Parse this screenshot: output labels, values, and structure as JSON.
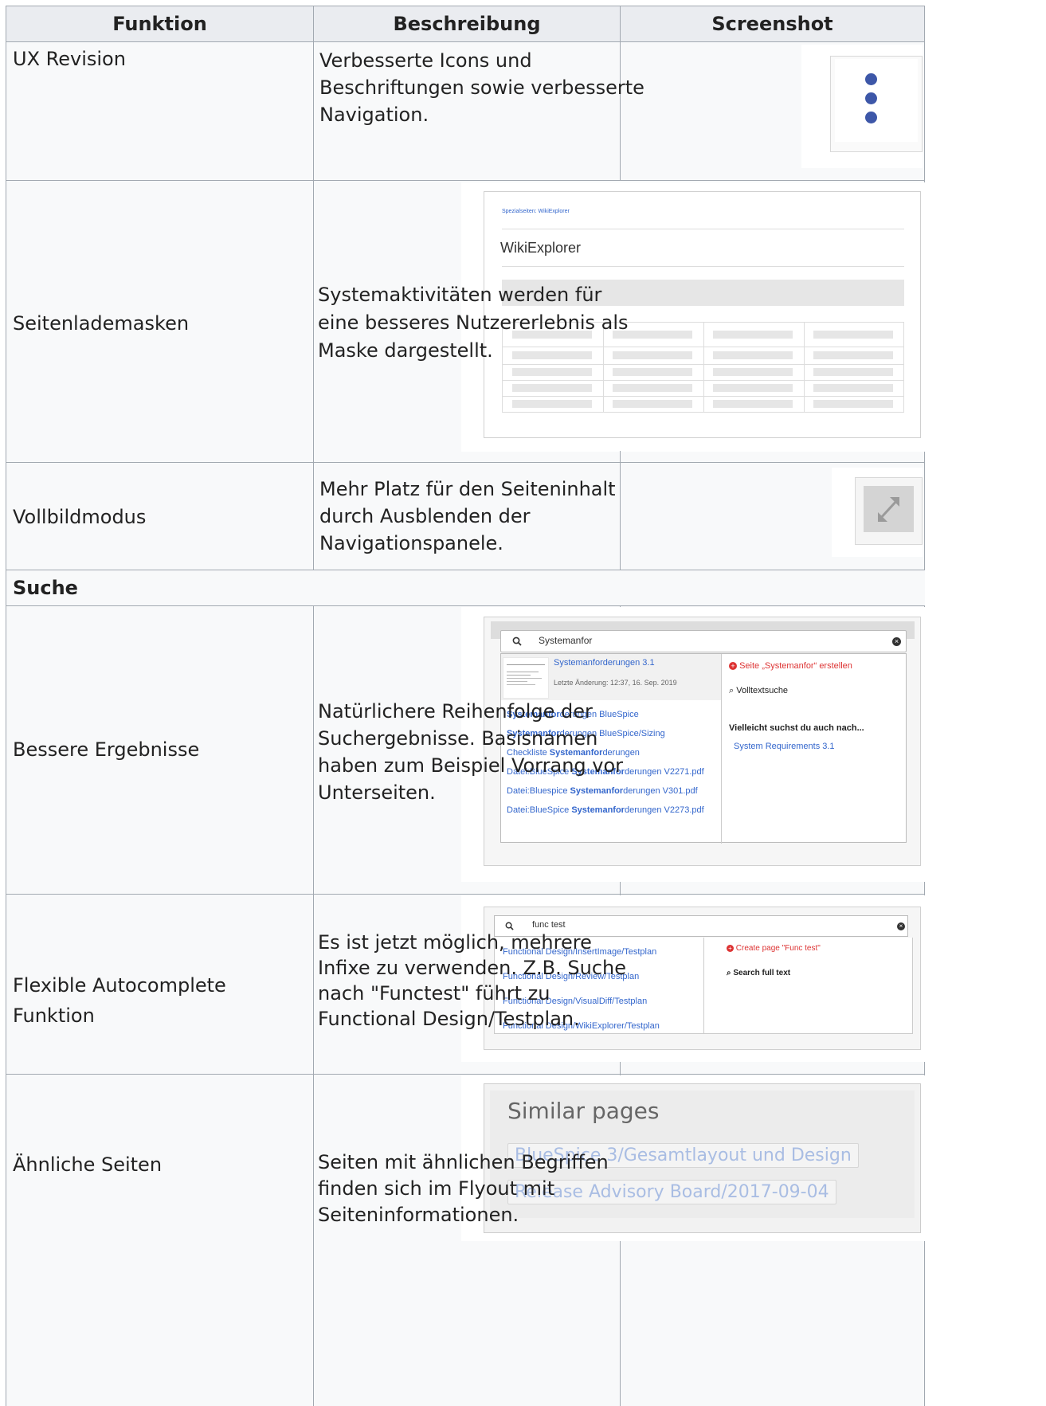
{
  "table": {
    "headers": [
      "Funktion",
      "Beschreibung",
      "Screenshot"
    ],
    "rows": [
      {
        "function": "UX Revision",
        "desc_lines": [
          "Verbesserte Icons und",
          "Beschriftungen sowie verbesserte",
          "Navigation."
        ]
      },
      {
        "function": "Seitenlademasken",
        "desc_lines": [
          "Systemaktivitäten werden für",
          "eine besseres Nutzererlebnis als",
          "Maske dargestellt."
        ]
      },
      {
        "function": "Vollbildmodus",
        "desc_lines": [
          "Mehr Platz für den Seiteninhalt",
          "durch Ausblenden der",
          "Navigationspanele."
        ]
      },
      {
        "section": "Suche"
      },
      {
        "function": "Bessere Ergebnisse",
        "desc_lines": [
          "Natürlichere Reihenfolge der",
          "Suchergebnisse. Basisnamen",
          "haben zum Beispiel Vorrang vor",
          "Unterseiten."
        ]
      },
      {
        "function": "Flexible Autocomplete Funktion",
        "desc_lines": [
          "Es ist jetzt möglich, mehrere",
          "Infixe zu verwenden. Z.B. Suche",
          "nach \"Functest\" führt zu",
          "Functional Design/Testplan."
        ]
      },
      {
        "function": "Ähnliche Seiten",
        "desc_lines": [
          "Seiten mit ähnlichen Begriffen",
          "finden sich im Flyout mit",
          "Seiteninformationen."
        ]
      }
    ]
  },
  "shots": {
    "wikiexplorer": {
      "breadcrumb": "Spezialseiten:  WikiExplorer",
      "title": "WikiExplorer"
    },
    "search1": {
      "query": "Systemanfor",
      "top_title": "Systemanforderungen 3.1",
      "top_meta": "Letzte Änderung: 12:37, 16. Sep. 2019",
      "results": [
        {
          "pre": "",
          "bold": "Systemanfor",
          "post": "derungen BlueSpice"
        },
        {
          "pre": "",
          "bold": "Systemanfor",
          "post": "derungen BlueSpice/Sizing"
        },
        {
          "pre": "Checkliste ",
          "bold": "Systemanfor",
          "post": "derungen"
        },
        {
          "pre": "Datei:BlueSpice ",
          "bold": "Systemanfor",
          "post": "derungen V2271.pdf"
        },
        {
          "pre": "Datei:Bluespice ",
          "bold": "Systemanfor",
          "post": "derungen V301.pdf"
        },
        {
          "pre": "Datei:BlueSpice ",
          "bold": "Systemanfor",
          "post": "derungen V2273.pdf"
        }
      ],
      "create": "Seite „Systemanfor“ erstellen",
      "fulltext": "Volltextsuche",
      "maybe_label": "Vielleicht suchst du auch nach...",
      "maybe_link": "System Requirements 3.1"
    },
    "search2": {
      "query": "func test",
      "results": [
        "Functional Design/InsertImage/Testplan",
        "Functional Design/Review/Testplan",
        "Functional Design/VisualDiff/Testplan",
        "Functional Design/WikiExplorer/Testplan"
      ],
      "create": "Create page \"Func test\"",
      "fulltext": "Search full text"
    },
    "similar": {
      "title": "Similar pages",
      "links": [
        "BlueSpice 3/Gesamtlayout und Design",
        "Release Advisory Board/2017-09-04"
      ]
    }
  },
  "colors": {
    "header_bg": "#eaecf0",
    "cell_bg": "#f8f9fa",
    "border": "#a2a9b1",
    "link": "#3366cc",
    "create_red": "#d33"
  }
}
